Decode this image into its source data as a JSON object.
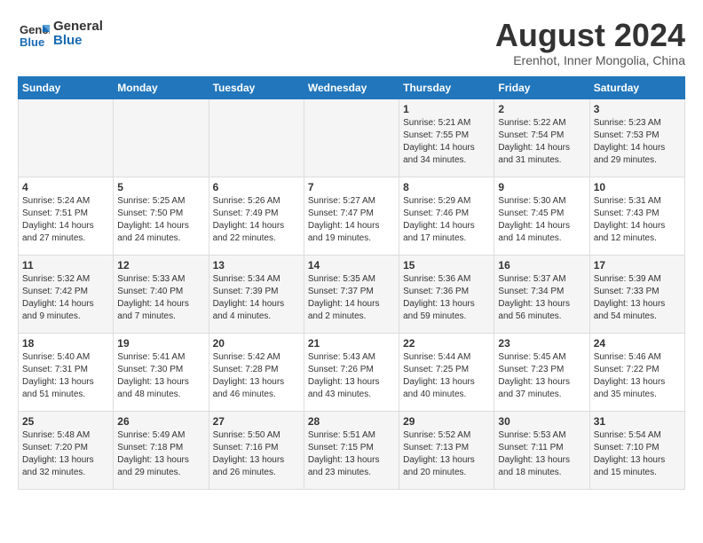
{
  "logo": {
    "line1": "General",
    "line2": "Blue"
  },
  "title": "August 2024",
  "subtitle": "Erenhot, Inner Mongolia, China",
  "days_of_week": [
    "Sunday",
    "Monday",
    "Tuesday",
    "Wednesday",
    "Thursday",
    "Friday",
    "Saturday"
  ],
  "weeks": [
    [
      {
        "day": "",
        "content": ""
      },
      {
        "day": "",
        "content": ""
      },
      {
        "day": "",
        "content": ""
      },
      {
        "day": "",
        "content": ""
      },
      {
        "day": "1",
        "content": "Sunrise: 5:21 AM\nSunset: 7:55 PM\nDaylight: 14 hours\nand 34 minutes."
      },
      {
        "day": "2",
        "content": "Sunrise: 5:22 AM\nSunset: 7:54 PM\nDaylight: 14 hours\nand 31 minutes."
      },
      {
        "day": "3",
        "content": "Sunrise: 5:23 AM\nSunset: 7:53 PM\nDaylight: 14 hours\nand 29 minutes."
      }
    ],
    [
      {
        "day": "4",
        "content": "Sunrise: 5:24 AM\nSunset: 7:51 PM\nDaylight: 14 hours\nand 27 minutes."
      },
      {
        "day": "5",
        "content": "Sunrise: 5:25 AM\nSunset: 7:50 PM\nDaylight: 14 hours\nand 24 minutes."
      },
      {
        "day": "6",
        "content": "Sunrise: 5:26 AM\nSunset: 7:49 PM\nDaylight: 14 hours\nand 22 minutes."
      },
      {
        "day": "7",
        "content": "Sunrise: 5:27 AM\nSunset: 7:47 PM\nDaylight: 14 hours\nand 19 minutes."
      },
      {
        "day": "8",
        "content": "Sunrise: 5:29 AM\nSunset: 7:46 PM\nDaylight: 14 hours\nand 17 minutes."
      },
      {
        "day": "9",
        "content": "Sunrise: 5:30 AM\nSunset: 7:45 PM\nDaylight: 14 hours\nand 14 minutes."
      },
      {
        "day": "10",
        "content": "Sunrise: 5:31 AM\nSunset: 7:43 PM\nDaylight: 14 hours\nand 12 minutes."
      }
    ],
    [
      {
        "day": "11",
        "content": "Sunrise: 5:32 AM\nSunset: 7:42 PM\nDaylight: 14 hours\nand 9 minutes."
      },
      {
        "day": "12",
        "content": "Sunrise: 5:33 AM\nSunset: 7:40 PM\nDaylight: 14 hours\nand 7 minutes."
      },
      {
        "day": "13",
        "content": "Sunrise: 5:34 AM\nSunset: 7:39 PM\nDaylight: 14 hours\nand 4 minutes."
      },
      {
        "day": "14",
        "content": "Sunrise: 5:35 AM\nSunset: 7:37 PM\nDaylight: 14 hours\nand 2 minutes."
      },
      {
        "day": "15",
        "content": "Sunrise: 5:36 AM\nSunset: 7:36 PM\nDaylight: 13 hours\nand 59 minutes."
      },
      {
        "day": "16",
        "content": "Sunrise: 5:37 AM\nSunset: 7:34 PM\nDaylight: 13 hours\nand 56 minutes."
      },
      {
        "day": "17",
        "content": "Sunrise: 5:39 AM\nSunset: 7:33 PM\nDaylight: 13 hours\nand 54 minutes."
      }
    ],
    [
      {
        "day": "18",
        "content": "Sunrise: 5:40 AM\nSunset: 7:31 PM\nDaylight: 13 hours\nand 51 minutes."
      },
      {
        "day": "19",
        "content": "Sunrise: 5:41 AM\nSunset: 7:30 PM\nDaylight: 13 hours\nand 48 minutes."
      },
      {
        "day": "20",
        "content": "Sunrise: 5:42 AM\nSunset: 7:28 PM\nDaylight: 13 hours\nand 46 minutes."
      },
      {
        "day": "21",
        "content": "Sunrise: 5:43 AM\nSunset: 7:26 PM\nDaylight: 13 hours\nand 43 minutes."
      },
      {
        "day": "22",
        "content": "Sunrise: 5:44 AM\nSunset: 7:25 PM\nDaylight: 13 hours\nand 40 minutes."
      },
      {
        "day": "23",
        "content": "Sunrise: 5:45 AM\nSunset: 7:23 PM\nDaylight: 13 hours\nand 37 minutes."
      },
      {
        "day": "24",
        "content": "Sunrise: 5:46 AM\nSunset: 7:22 PM\nDaylight: 13 hours\nand 35 minutes."
      }
    ],
    [
      {
        "day": "25",
        "content": "Sunrise: 5:48 AM\nSunset: 7:20 PM\nDaylight: 13 hours\nand 32 minutes."
      },
      {
        "day": "26",
        "content": "Sunrise: 5:49 AM\nSunset: 7:18 PM\nDaylight: 13 hours\nand 29 minutes."
      },
      {
        "day": "27",
        "content": "Sunrise: 5:50 AM\nSunset: 7:16 PM\nDaylight: 13 hours\nand 26 minutes."
      },
      {
        "day": "28",
        "content": "Sunrise: 5:51 AM\nSunset: 7:15 PM\nDaylight: 13 hours\nand 23 minutes."
      },
      {
        "day": "29",
        "content": "Sunrise: 5:52 AM\nSunset: 7:13 PM\nDaylight: 13 hours\nand 20 minutes."
      },
      {
        "day": "30",
        "content": "Sunrise: 5:53 AM\nSunset: 7:11 PM\nDaylight: 13 hours\nand 18 minutes."
      },
      {
        "day": "31",
        "content": "Sunrise: 5:54 AM\nSunset: 7:10 PM\nDaylight: 13 hours\nand 15 minutes."
      }
    ]
  ]
}
